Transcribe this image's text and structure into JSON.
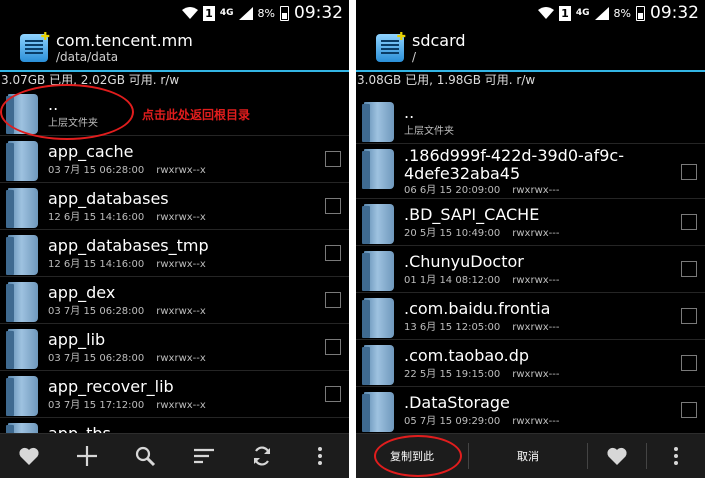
{
  "status_bar": {
    "time": "09:32",
    "battery": "8%",
    "network": "4G",
    "sim": "1"
  },
  "left": {
    "header": {
      "title": "com.tencent.mm",
      "path": "/data/data"
    },
    "storage": "3.07GB 已用, 2.02GB 可用. r/w",
    "parent": {
      "name": "..",
      "label": "上层文件夹"
    },
    "annotation": "点击此处返回根目录",
    "items": [
      {
        "name": "app_cache",
        "date": "03 7月 15 06:28:00",
        "perms": "rwxrwx--x"
      },
      {
        "name": "app_databases",
        "date": "12 6月 15 14:16:00",
        "perms": "rwxrwx--x"
      },
      {
        "name": "app_databases_tmp",
        "date": "12 6月 15 14:16:00",
        "perms": "rwxrwx--x"
      },
      {
        "name": "app_dex",
        "date": "03 7月 15 06:28:00",
        "perms": "rwxrwx--x"
      },
      {
        "name": "app_lib",
        "date": "03 7月 15 06:28:00",
        "perms": "rwxrwx--x"
      },
      {
        "name": "app_recover_lib",
        "date": "03 7月 15 17:12:00",
        "perms": "rwxrwx--x"
      },
      {
        "name": "app_tbs",
        "date": "",
        "perms": ""
      }
    ],
    "toolbar": [
      "heart-icon",
      "plus-icon",
      "search-icon",
      "sort-icon",
      "refresh-icon",
      "more-icon"
    ]
  },
  "right": {
    "header": {
      "title": "sdcard",
      "path": "/"
    },
    "storage": "3.08GB 已用, 1.98GB 可用. r/w",
    "parent": {
      "name": "..",
      "label": "上层文件夹"
    },
    "items": [
      {
        "name": ".186d999f-422d-39d0-af9c-4defe32aba45",
        "date": "06 6月 15 20:09:00",
        "perms": "rwxrwx---"
      },
      {
        "name": ".BD_SAPI_CACHE",
        "date": "20 5月 15 10:49:00",
        "perms": "rwxrwx---"
      },
      {
        "name": ".ChunyuDoctor",
        "date": "01 1月 14 08:12:00",
        "perms": "rwxrwx---"
      },
      {
        "name": ".com.baidu.frontia",
        "date": "13 6月 15 12:05:00",
        "perms": "rwxrwx---"
      },
      {
        "name": ".com.taobao.dp",
        "date": "22 5月 15 19:15:00",
        "perms": "rwxrwx---"
      },
      {
        "name": ".DataStorage",
        "date": "05 7月 15 09:29:00",
        "perms": "rwxrwx---"
      }
    ],
    "toolbar": {
      "copy_here": "复制到此",
      "cancel": "取消"
    }
  }
}
